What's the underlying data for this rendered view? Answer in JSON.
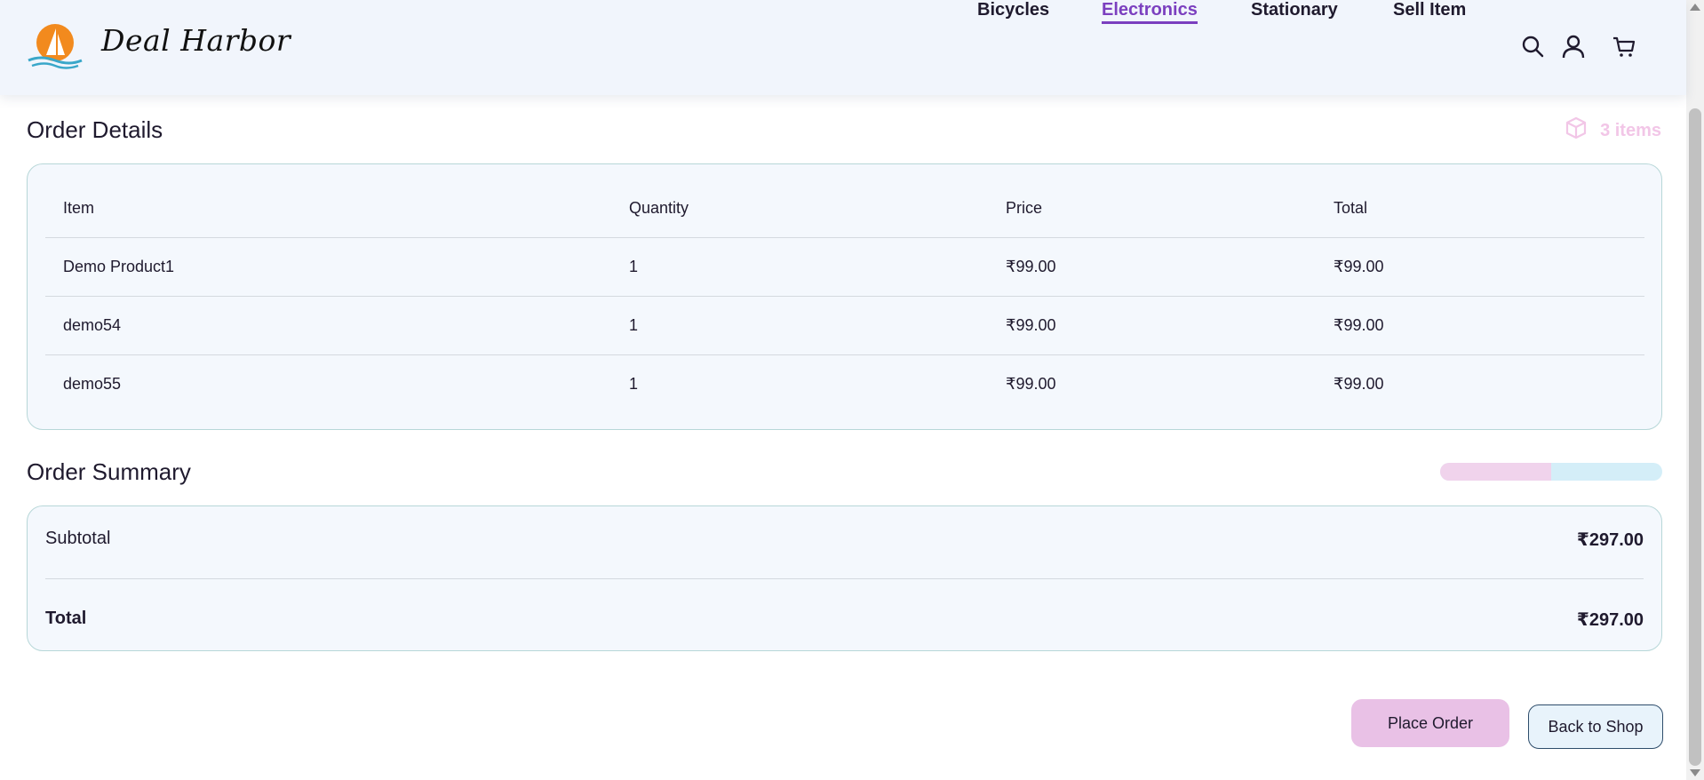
{
  "header": {
    "brand": "Deal Harbor",
    "nav": [
      {
        "label": "Bicycles",
        "active": false
      },
      {
        "label": "Electronics",
        "active": true
      },
      {
        "label": "Stationary",
        "active": false
      },
      {
        "label": "Sell Item",
        "active": false
      }
    ],
    "icons": [
      "search-icon",
      "user-icon",
      "cart-icon"
    ]
  },
  "order_details": {
    "title": "Order Details",
    "item_count": "3 items",
    "columns": [
      "Item",
      "Quantity",
      "Price",
      "Total"
    ],
    "rows": [
      {
        "item": "Demo Product1",
        "quantity": "1",
        "price": "₹99.00",
        "total": "₹99.00"
      },
      {
        "item": "demo54",
        "quantity": "1",
        "price": "₹99.00",
        "total": "₹99.00"
      },
      {
        "item": "demo55",
        "quantity": "1",
        "price": "₹99.00",
        "total": "₹99.00"
      }
    ]
  },
  "order_summary": {
    "title": "Order Summary",
    "progress_fraction": 0.5,
    "subtotal_label": "Subtotal",
    "subtotal_value": "₹297.00",
    "total_label": "Total",
    "total_value": "₹297.00"
  },
  "actions": {
    "place_order": "Place Order",
    "back_to_shop": "Back to Shop"
  },
  "colors": {
    "accent": "#7b3fbf",
    "place_order_bg": "#e9c1e6",
    "card_bg": "#f4f8fd",
    "card_border": "#b7d7d8"
  }
}
